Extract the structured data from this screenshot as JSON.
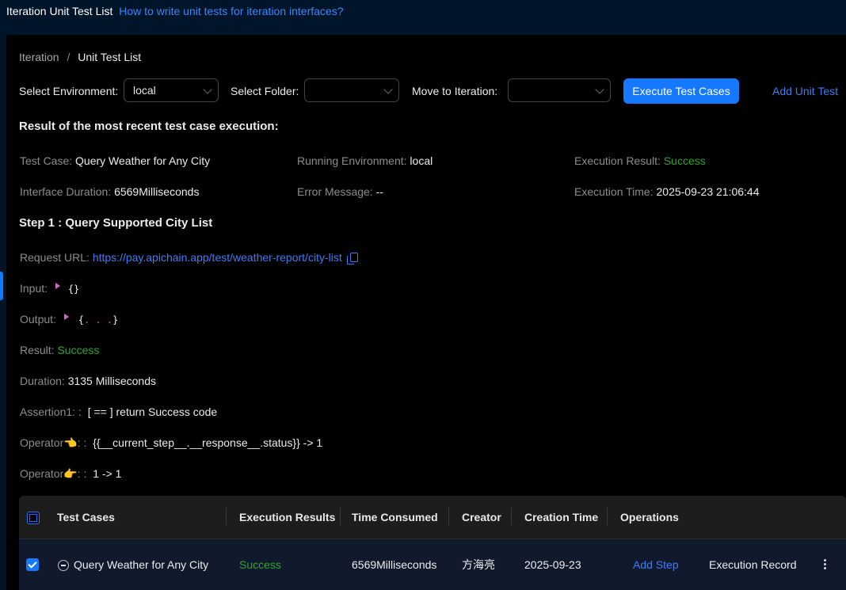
{
  "header": {
    "title": "Iteration Unit Test List",
    "help_link": "How to write unit tests for iteration interfaces?"
  },
  "breadcrumb": {
    "root": "Iteration",
    "separator": "/",
    "current": "Unit Test List"
  },
  "toolbar": {
    "env_label": "Select Environment:",
    "env_value": "local",
    "folder_label": "Select Folder:",
    "folder_value": "",
    "move_label": "Move to Iteration:",
    "move_value": "",
    "execute_button": "Execute Test Cases",
    "add_unit_test": "Add Unit Test"
  },
  "result": {
    "heading": "Result of the most recent test case execution:",
    "test_case_label": "Test Case:",
    "test_case_value": "Query Weather for Any City",
    "running_env_label": "Running Environment:",
    "running_env_value": "local",
    "exec_result_label": "Execution Result:",
    "exec_result_value": "Success",
    "duration_label": "Interface Duration:",
    "duration_value": "6569Milliseconds",
    "error_label": "Error Message:",
    "error_value": "--",
    "exec_time_label": "Execution Time:",
    "exec_time_value": "2025-09-23 21:06:44"
  },
  "step": {
    "heading": "Step 1 :  Query Supported City List",
    "request_url_label": "Request URL:",
    "request_url_value": "https://pay.apichain.app/test/weather-report/city-list",
    "input_label": "Input:",
    "input_value": "{}",
    "output_label": "Output:",
    "output_open": "{",
    "output_dots": ". . .",
    "output_close": "}",
    "result_label": "Result:",
    "result_value": "Success",
    "duration_label": "Duration:",
    "duration_value": "3135 Milliseconds",
    "assertion_label": "Assertion1: :",
    "assertion_value": "[ == ] return Success code",
    "operator1_label": "Operator👈: :",
    "operator1_value": "{{__current_step__.__response__.status}} -> 1",
    "operator2_label": "Operator👉: :",
    "operator2_value": "1 -> 1"
  },
  "table": {
    "columns": [
      "Test Cases",
      "Execution Results",
      "Time Consumed",
      "Creator",
      "Creation Time",
      "Operations"
    ],
    "rows": [
      {
        "name": "Query Weather for Any City",
        "result": "Success",
        "time": "6569Milliseconds",
        "creator": "方海亮",
        "created": "2025-09-23",
        "add_step": "Add Step",
        "exec_record": "Execution Record"
      }
    ]
  },
  "colors": {
    "primary": "#1677ff",
    "success": "#2fa52f",
    "link": "#3f7cf0",
    "background": "#000000",
    "header_bg": "#001529"
  }
}
